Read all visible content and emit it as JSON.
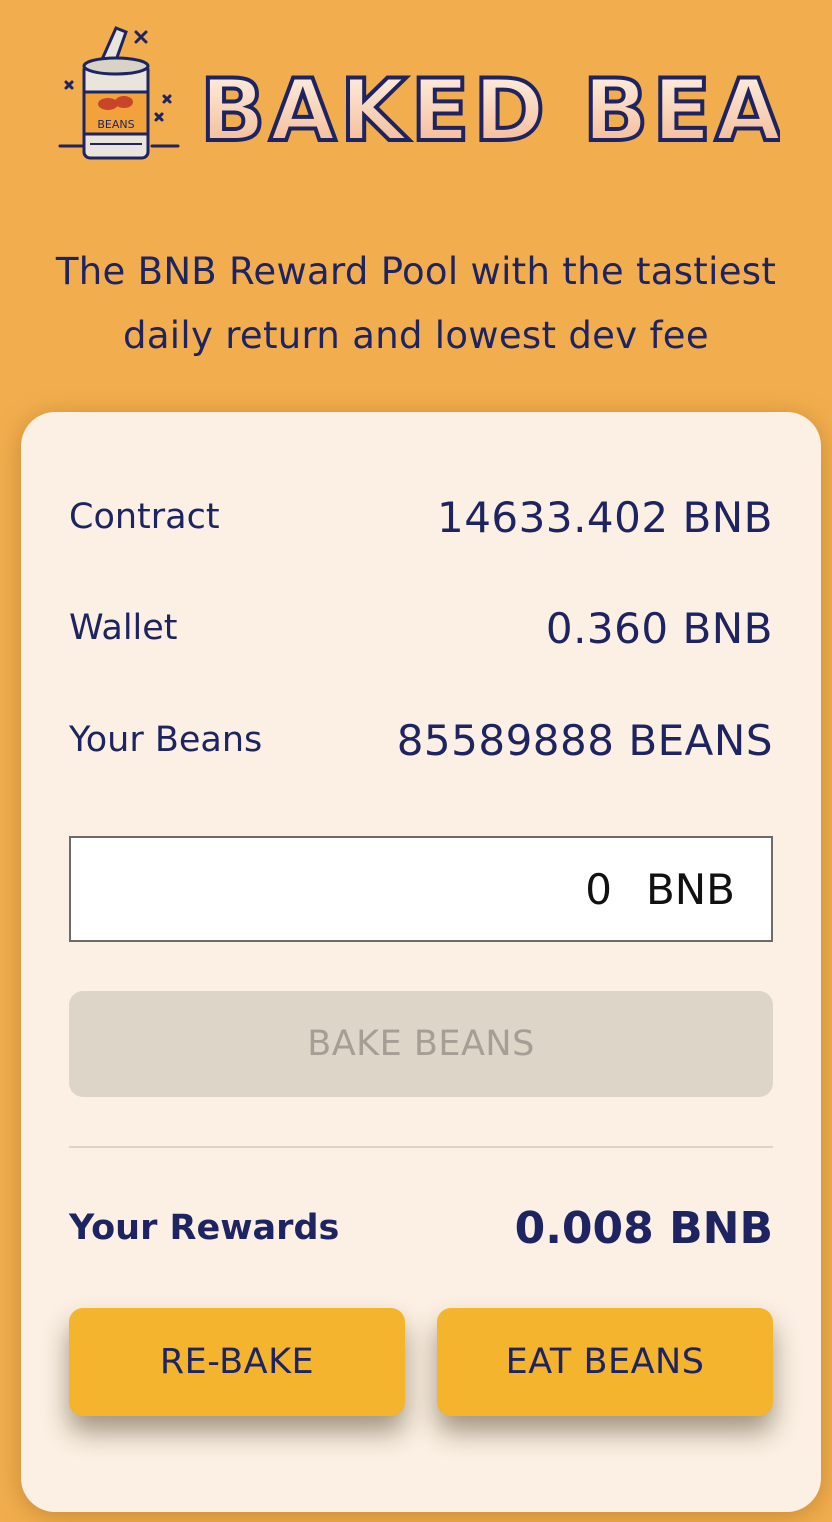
{
  "brand": {
    "logo_text": "BAKED BEANS",
    "can_label": "BEANS"
  },
  "tagline": {
    "line1": "The BNB Reward Pool with the tastiest",
    "line2": "daily return and lowest dev fee"
  },
  "stats": {
    "contract_label": "Contract",
    "contract_value": "14633.402 BNB",
    "wallet_label": "Wallet",
    "wallet_value": "0.360 BNB",
    "beans_label": "Your Beans",
    "beans_value": "85589888 BEANS"
  },
  "deposit": {
    "amount": "0",
    "unit": "BNB"
  },
  "bake_button": "BAKE BEANS",
  "rewards": {
    "label": "Your Rewards",
    "value": "0.008 BNB"
  },
  "actions": {
    "rebake": "RE-BAKE",
    "eat": "EAT BEANS"
  },
  "colors": {
    "background": "#f2ae4e",
    "card": "#fbf0e3",
    "text": "#1d2461",
    "accent_button": "#f4b42d",
    "disabled_button": "#ddd5c7"
  }
}
